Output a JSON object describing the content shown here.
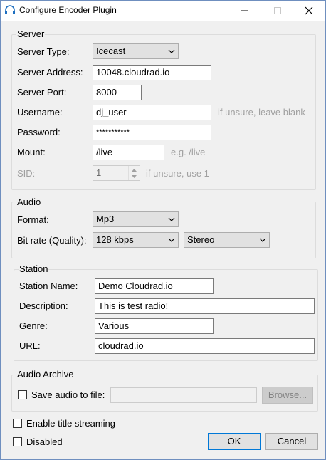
{
  "window": {
    "title": "Configure Encoder Plugin",
    "icon": "headphones-icon"
  },
  "server": {
    "legend": "Server",
    "server_type_label": "Server Type:",
    "server_type_value": "Icecast",
    "server_address_label": "Server Address:",
    "server_address_value": "10048.cloudrad.io",
    "server_port_label": "Server Port:",
    "server_port_value": "8000",
    "username_label": "Username:",
    "username_value": "dj_user",
    "username_hint": "if unsure, leave blank",
    "password_label": "Password:",
    "password_value": "***********",
    "mount_label": "Mount:",
    "mount_value": "/live",
    "mount_hint": "e.g. /live",
    "sid_label": "SID:",
    "sid_value": "1",
    "sid_hint": "if unsure, use 1"
  },
  "audio": {
    "legend": "Audio",
    "format_label": "Format:",
    "format_value": "Mp3",
    "bitrate_label": "Bit rate (Quality):",
    "bitrate_value": "128 kbps",
    "channels_value": "Stereo"
  },
  "station": {
    "legend": "Station",
    "name_label": "Station Name:",
    "name_value": "Demo Cloudrad.io",
    "description_label": "Description:",
    "description_value": "This is test radio!",
    "genre_label": "Genre:",
    "genre_value": "Various",
    "url_label": "URL:",
    "url_value": "cloudrad.io"
  },
  "archive": {
    "legend": "Audio Archive",
    "save_label": "Save audio to file:",
    "save_checked": false,
    "path_value": "",
    "browse_label": "Browse..."
  },
  "options": {
    "title_streaming_label": "Enable title streaming",
    "title_streaming_checked": false,
    "disabled_label": "Disabled",
    "disabled_checked": false
  },
  "buttons": {
    "ok_label": "OK",
    "cancel_label": "Cancel"
  }
}
